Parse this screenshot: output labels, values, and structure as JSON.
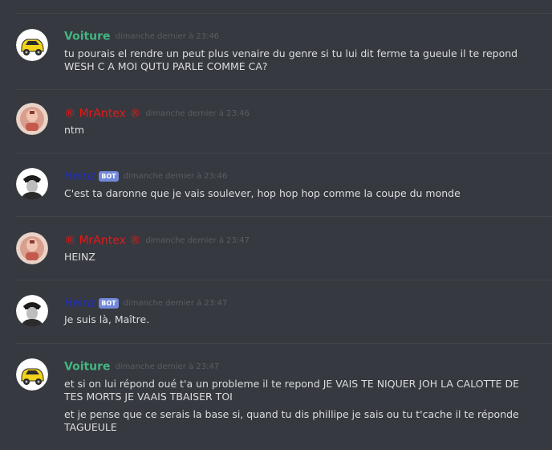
{
  "messages": [
    {
      "username": "Voiture",
      "username_color": "#43b581",
      "timestamp": "dimanche dernier à 23:46",
      "avatar_icon": "yellow-car-icon",
      "lines": [
        "tu pourais el rendre un peut plus venaire du genre si tu lui dit ferme ta gueule il te repond WESH C A MOI QUTU PARLE COMME CA?"
      ]
    },
    {
      "username": "® MrAntex ®",
      "username_color": "#e21a1a",
      "timestamp": "dimanche dernier à 23:46",
      "avatar_icon": "portrait-avatar-icon",
      "lines": [
        "ntm"
      ]
    },
    {
      "username": "Heinz",
      "username_color": "#1f2fc7",
      "bot_tag": "BOT",
      "timestamp": "dimanche dernier à 23:46",
      "avatar_icon": "officer-cap-avatar-icon",
      "lines": [
        "C'est ta daronne que je vais soulever, hop hop hop comme la coupe du monde"
      ]
    },
    {
      "username": "® MrAntex ®",
      "username_color": "#e21a1a",
      "timestamp": "dimanche dernier à 23:47",
      "avatar_icon": "portrait-avatar-icon",
      "lines": [
        "HEINZ"
      ]
    },
    {
      "username": "Heinz",
      "username_color": "#1f2fc7",
      "bot_tag": "BOT",
      "timestamp": "dimanche dernier à 23:47",
      "avatar_icon": "officer-cap-avatar-icon",
      "lines": [
        "Je suis là, Maître."
      ]
    },
    {
      "username": "Voiture",
      "username_color": "#43b581",
      "timestamp": "dimanche dernier à 23:47",
      "avatar_icon": "yellow-car-icon",
      "lines": [
        "et si on lui répond oué t'a un probleme il te repond JE VAIS TE NIQUER JOH LA CALOTTE DE TES MORTS JE VAAIS TBAISER TOI",
        "et je pense que ce serais la base si, quand tu dis phillipe je sais ou tu t'cache il te réponde TAGUEULE"
      ]
    }
  ]
}
